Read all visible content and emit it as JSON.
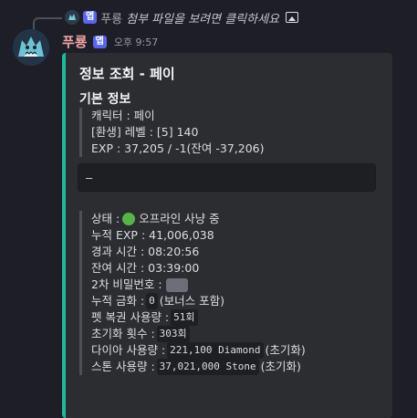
{
  "reply": {
    "avatar_icon": "dragon-avatar-icon",
    "app_badge": "앱",
    "author": "푸룡",
    "text": "첨부 파일을 보려면 클릭하세요"
  },
  "message": {
    "author": "푸룡",
    "app_badge": "앱",
    "timestamp": "오후 9:57",
    "author_color": "#f2a5a5"
  },
  "embed": {
    "accent_color": "#1abc9c",
    "title": "정보 조회 - 페이",
    "field_title": "기본 정보",
    "basic_lines": [
      "캐릭터 : 페이",
      "[환생] 레벨 : [5] 140",
      "EXP : 37,205 / -1(잔여 -37,206)"
    ],
    "code_text": "—",
    "status": {
      "label": "상태 : ",
      "value": "오프라인 사냥 중",
      "dot_color": "#56b548"
    },
    "lines": {
      "cumulative_exp": "누적 EXP : 41,006,038",
      "elapsed": "경과 시간 : 08:20:56",
      "remaining": "잔여 시간 : 03:39:00",
      "password_label": "2차 비밀번호 : ",
      "gold_label": "누적 금화 : ",
      "gold_code": "0",
      "gold_suffix": "(보너스 포함)",
      "pet_label": "펫 복권 사용량 : ",
      "pet_code": "51회",
      "reset_label": "초기화 횟수 : ",
      "reset_code": "303회",
      "diamond_label": "다이아 사용량 : ",
      "diamond_code": "221,100 Diamond",
      "diamond_suffix": "(초기화)",
      "stone_label": "스톤 사용량 : ",
      "stone_code": "37,021,000 Stone",
      "stone_suffix": "(초기화)"
    }
  }
}
